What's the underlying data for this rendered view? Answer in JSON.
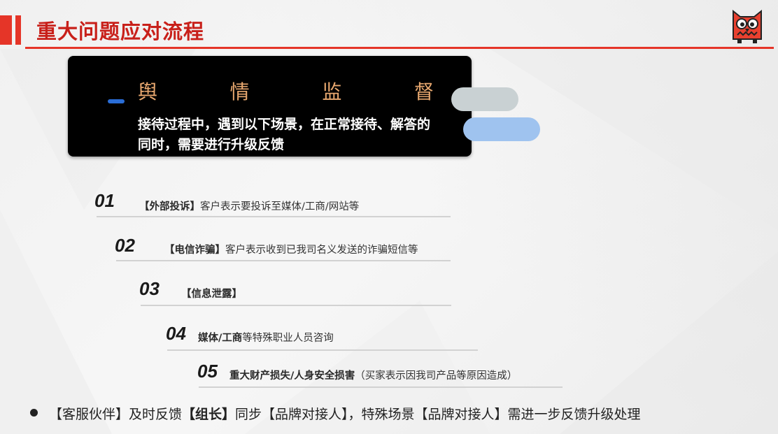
{
  "header": {
    "title": "重大问题应对流程",
    "logo_icon": "owl-logo-icon",
    "accent_color": "#e53528"
  },
  "card": {
    "heading_chars": [
      "舆",
      "情",
      "监",
      "督"
    ],
    "text": "接待过程中，遇到以下场景，在正常接待、解答的同时，需要进行升级反馈"
  },
  "items": [
    {
      "num": "01",
      "tag": "【外部投诉】",
      "text": "客户表示要投诉至媒体/工商/网站等"
    },
    {
      "num": "02",
      "tag": "【电信诈骗】",
      "text": "客户表示收到已我司名义发送的诈骗短信等"
    },
    {
      "num": "03",
      "tag": "【信息泄露】",
      "text": ""
    },
    {
      "num": "04",
      "tag": "媒体/工商",
      "text": "等特殊职业人员咨询"
    },
    {
      "num": "05",
      "tag": "重大财产损失/人身安全损害",
      "text": "（买家表示因我司产品等原因造成）"
    }
  ],
  "footer": {
    "p1": "【客服伙伴】及时反馈",
    "p2": "【组长】",
    "p3": "同步【品牌对接人】，特殊场景【品牌对接人】需进一步反馈升级处理"
  }
}
